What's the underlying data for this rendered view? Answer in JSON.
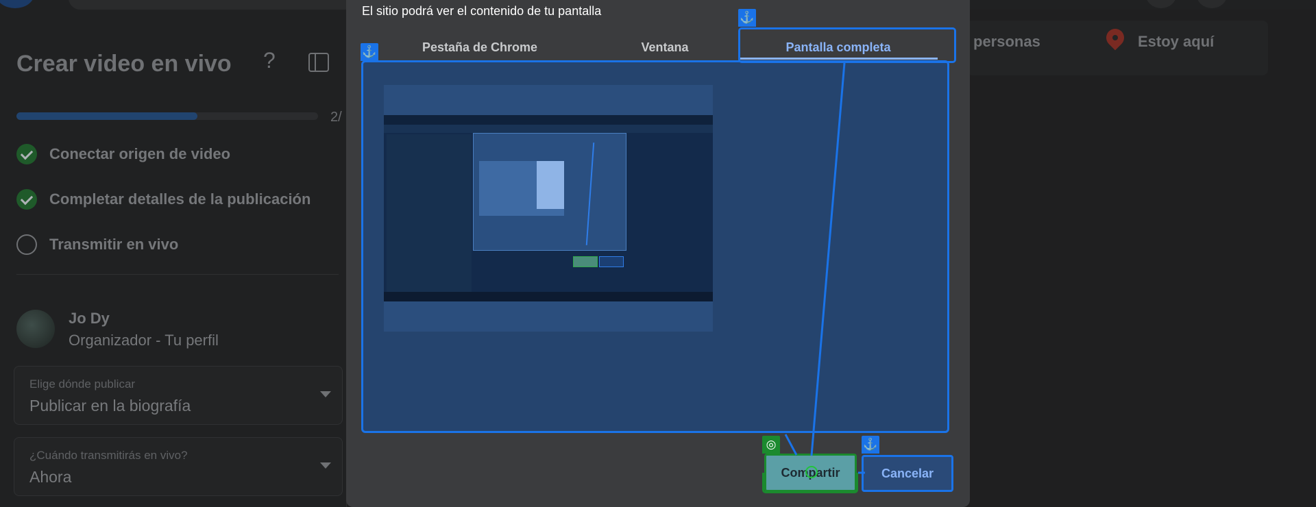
{
  "background": {
    "title": "Crear video en vivo",
    "progress_count": "2/",
    "progress_fraction": 0.6,
    "steps": [
      {
        "label": "Conectar origen de video",
        "done": true
      },
      {
        "label": "Completar detalles de la publicación",
        "done": true
      },
      {
        "label": "Transmitir en vivo",
        "done": false
      }
    ],
    "user": {
      "name": "Jo Dy",
      "role": "Organizador - Tu perfil"
    },
    "publish_field": {
      "label": "Elige dónde publicar",
      "value": "Publicar en la biografía"
    },
    "schedule_field": {
      "label": "¿Cuándo transmitirás en vivo?",
      "value": "Ahora"
    },
    "right_items": {
      "people": "personas",
      "location": "Estoy aquí"
    }
  },
  "dialog": {
    "title": "El sitio podrá ver el contenido de tu pantalla",
    "tabs": [
      {
        "label": "Pestaña de Chrome",
        "active": false
      },
      {
        "label": "Ventana",
        "active": false
      },
      {
        "label": "Pantalla completa",
        "active": true
      }
    ],
    "buttons": {
      "share": "Compartir",
      "cancel": "Cancelar"
    }
  },
  "colors": {
    "accent": "#8ab4f8",
    "highlight_blue": "#1a73e8",
    "highlight_green": "#1b8a2e"
  },
  "icons": [
    "help-icon",
    "side-panel-icon",
    "check-icon",
    "location-pin-icon",
    "anchor-icon",
    "target-icon"
  ]
}
